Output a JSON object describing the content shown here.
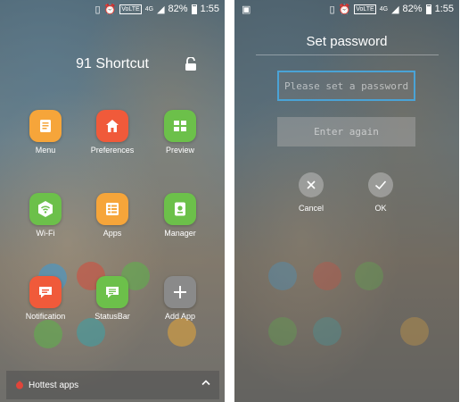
{
  "status_bar": {
    "battery": "82%",
    "time": "1:55",
    "network": "4G",
    "volte": "VoLTE"
  },
  "left_screen": {
    "title": "91 Shortcut",
    "apps": [
      {
        "label": "Menu",
        "icon": "menu-icon",
        "color": "#f6a53a"
      },
      {
        "label": "Preferences",
        "icon": "home-icon",
        "color": "#f05a3a"
      },
      {
        "label": "Preview",
        "icon": "grid-icon",
        "color": "#6cc04a"
      },
      {
        "label": "Wi-Fi",
        "icon": "wifi-icon",
        "color": "#6cc04a"
      },
      {
        "label": "Apps",
        "icon": "apps-list-icon",
        "color": "#f6a53a"
      },
      {
        "label": "Manager",
        "icon": "phone-manager-icon",
        "color": "#6cc04a"
      },
      {
        "label": "Notification",
        "icon": "message-icon",
        "color": "#f05a3a"
      },
      {
        "label": "StatusBar",
        "icon": "statusbar-icon",
        "color": "#6cc04a"
      },
      {
        "label": "Add App",
        "icon": "plus-icon",
        "color": "#8a8a8a"
      }
    ],
    "hottest": {
      "label": "Hottest apps"
    }
  },
  "right_screen": {
    "title": "Set password",
    "password_placeholder": "Please set a password",
    "confirm_placeholder": "Enter again",
    "cancel_label": "Cancel",
    "ok_label": "OK"
  }
}
